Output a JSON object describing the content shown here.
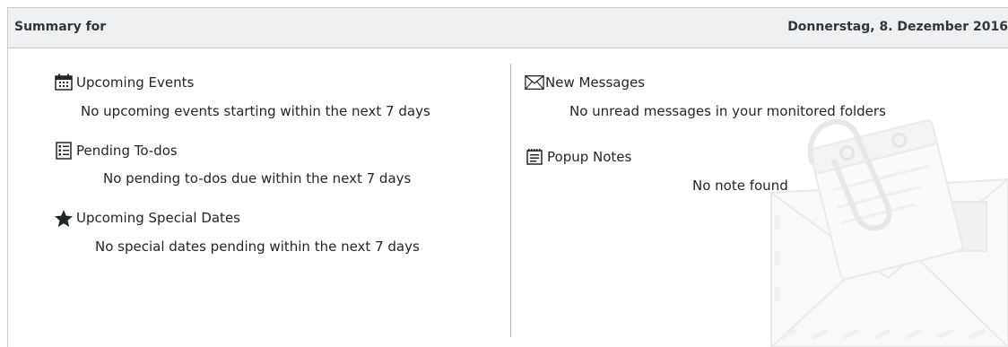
{
  "header": {
    "title": "Summary for",
    "date": "Donnerstag, 8. Dezember 2016"
  },
  "left": {
    "events": {
      "title": "Upcoming Events",
      "message": "No upcoming events starting within the next 7 days",
      "icon": "calendar-icon"
    },
    "todos": {
      "title": "Pending To-dos",
      "message": "No pending to-dos due within the next 7 days",
      "icon": "todo-list-icon"
    },
    "special_dates": {
      "title": "Upcoming Special Dates",
      "message": "No special dates pending within the next 7 days",
      "icon": "star-icon"
    }
  },
  "right": {
    "messages": {
      "title": "New Messages",
      "message": "No unread messages in your monitored folders",
      "icon": "envelope-icon"
    },
    "notes": {
      "title": "Popup Notes",
      "message": "No note found",
      "icon": "note-icon"
    }
  },
  "colors": {
    "header_bg": "#eff0f1",
    "text": "#232627",
    "border": "#c8cbcd"
  }
}
